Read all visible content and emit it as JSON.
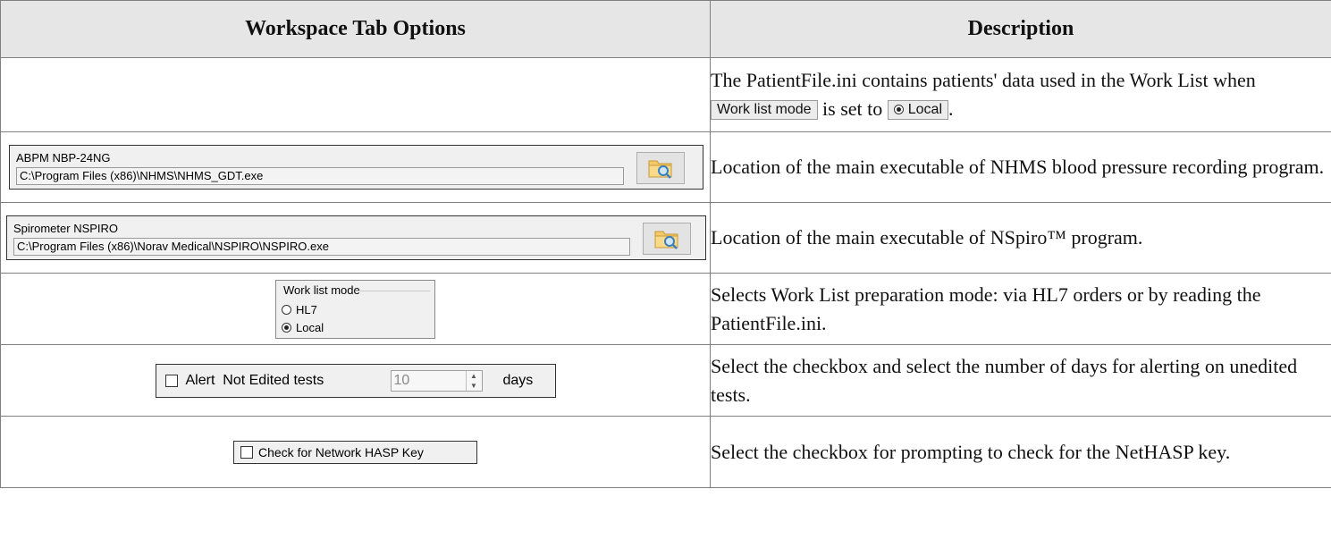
{
  "headers": {
    "options": "Workspace Tab Options",
    "description": "Description"
  },
  "rows": {
    "patientfile": {
      "desc_part1": "The PatientFile.ini contains patients' data used in the Work List when ",
      "inline_mode": "Work list mode",
      "desc_part2": " is set to ",
      "inline_local": "Local",
      "desc_part3": "."
    },
    "abpm": {
      "label": "ABPM NBP-24NG",
      "path": "C:\\Program Files (x86)\\NHMS\\NHMS_GDT.exe",
      "browse_icon": "folder-search-icon",
      "description": "Location of the main executable of NHMS blood pressure recording program."
    },
    "spirometer": {
      "label": "Spirometer NSPIRO",
      "path": "C:\\Program Files (x86)\\Norav Medical\\NSPIRO\\NSPIRO.exe",
      "browse_icon": "folder-search-icon",
      "description": "Location of the main executable of NSpiro™ program."
    },
    "worklist": {
      "legend": "Work list mode",
      "option_hl7": "HL7",
      "option_local": "Local",
      "selected": "Local",
      "description": "Selects Work List preparation mode: via HL7 orders or by reading the PatientFile.ini."
    },
    "alert": {
      "label": "Alert  Not Edited tests",
      "value": "10",
      "unit": "days",
      "checked": false,
      "description": "Select the checkbox and select the number of days for alerting on unedited tests."
    },
    "hasp": {
      "label": "Check for Network HASP Key",
      "checked": false,
      "description": "Select the checkbox for prompting to check for the NetHASP key."
    }
  }
}
